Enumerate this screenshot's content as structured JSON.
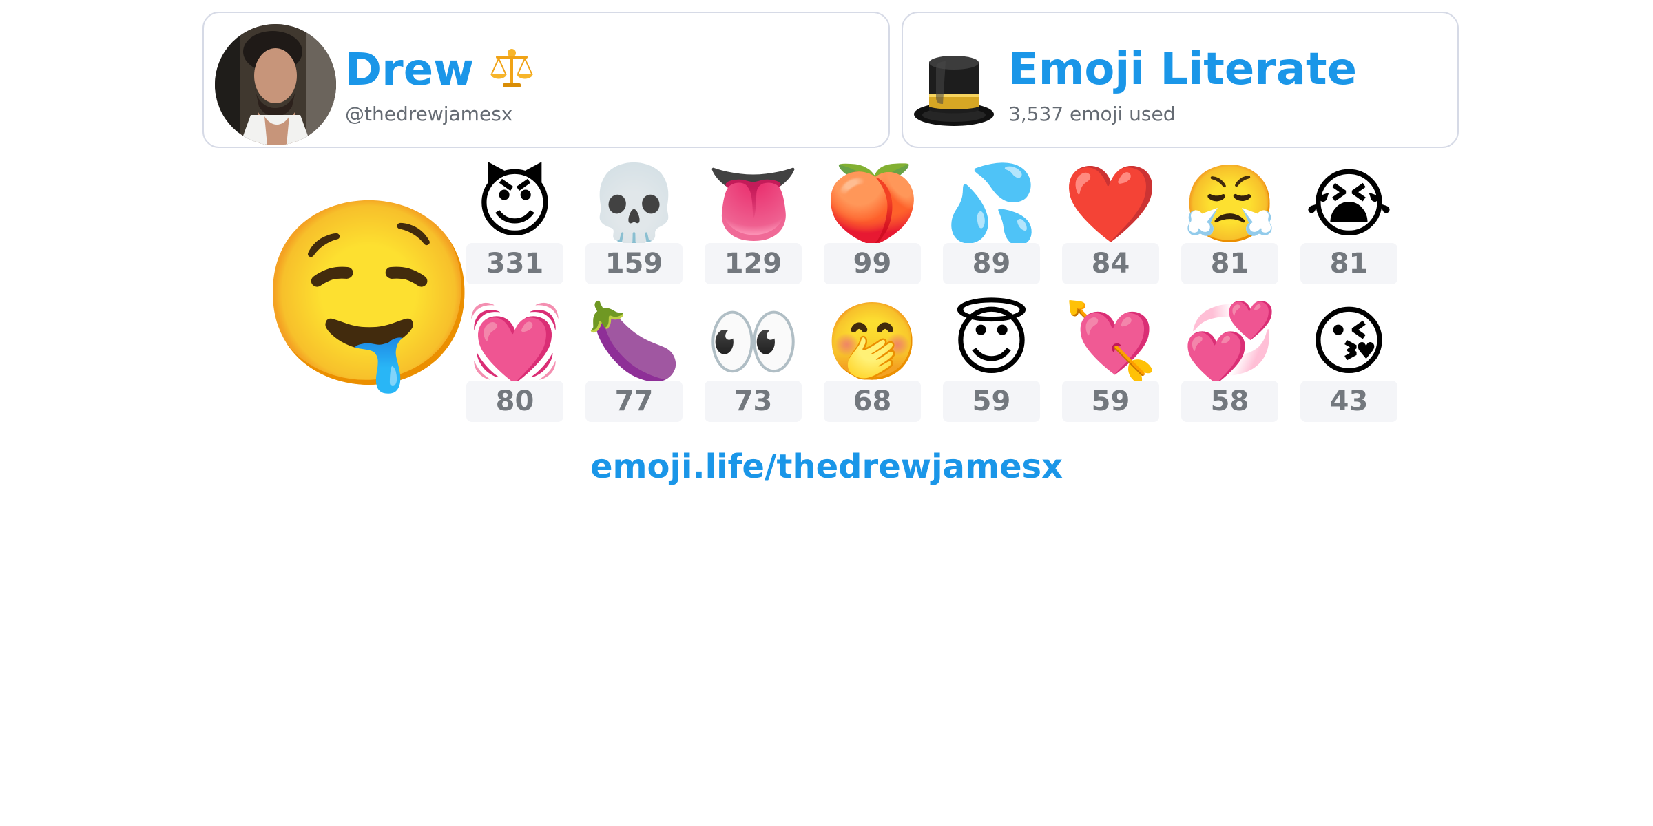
{
  "profile": {
    "name": "Drew",
    "handle": "@thedrewjamesx",
    "avatar_icon": "profile-photo"
  },
  "rank": {
    "title": "Emoji Literate",
    "count_text": "3,537 emoji used",
    "icon": "top-hat-icon"
  },
  "hero": {
    "emoji": "🤤",
    "name": "drooling-face"
  },
  "emoji_grid": [
    {
      "emoji": "😈",
      "count": 331,
      "name": "smiling-devil"
    },
    {
      "emoji": "💀",
      "count": 159,
      "name": "skull"
    },
    {
      "emoji": "👅",
      "count": 129,
      "name": "tongue"
    },
    {
      "emoji": "🍑",
      "count": 99,
      "name": "peach"
    },
    {
      "emoji": "💦",
      "count": 89,
      "name": "sweat-droplets"
    },
    {
      "emoji": "❤️",
      "count": 84,
      "name": "red-heart"
    },
    {
      "emoji": "😤",
      "count": 81,
      "name": "face-with-steam"
    },
    {
      "emoji": "😭",
      "count": 81,
      "name": "loudly-crying-face"
    },
    {
      "emoji": "💓",
      "count": 80,
      "name": "beating-heart"
    },
    {
      "emoji": "🍆",
      "count": 77,
      "name": "eggplant"
    },
    {
      "emoji": "👀",
      "count": 73,
      "name": "eyes"
    },
    {
      "emoji": "🤭",
      "count": 68,
      "name": "face-with-hand-over-mouth"
    },
    {
      "emoji": "😇",
      "count": 59,
      "name": "smiling-face-with-halo"
    },
    {
      "emoji": "💘",
      "count": 59,
      "name": "heart-with-arrow"
    },
    {
      "emoji": "💞",
      "count": 58,
      "name": "revolving-hearts"
    },
    {
      "emoji": "😘",
      "count": 43,
      "name": "face-blowing-kiss"
    }
  ],
  "link": "emoji.life/thedrewjamesx",
  "colors": {
    "accent": "#1a96e8",
    "muted_text": "#656b73",
    "count_text": "#73787e",
    "count_bg": "#f4f5f8",
    "card_border": "#d6dae6"
  }
}
